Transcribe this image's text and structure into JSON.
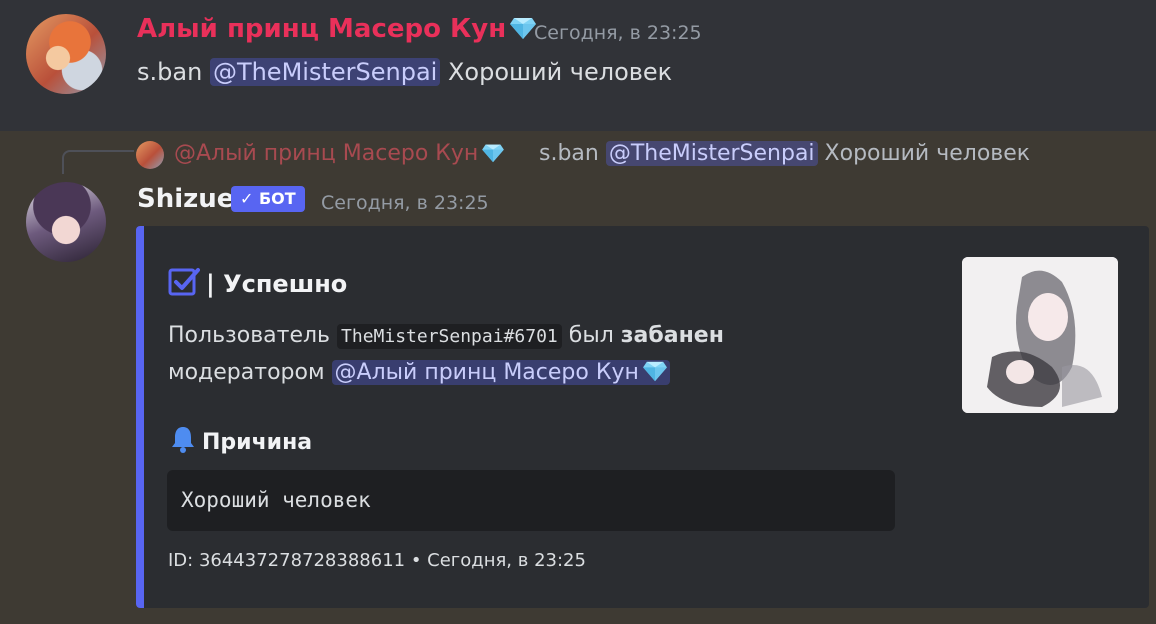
{
  "message1": {
    "author": "Алый принц Масеро Кун",
    "timestamp": "Сегодня, в 23:25",
    "command": "s.ban",
    "mention": "@TheMisterSenpai",
    "text": "Хороший человек"
  },
  "reply": {
    "author": "@Алый принц Масеро Кун",
    "command": "s.ban",
    "mention": "@TheMisterSenpai",
    "text": "Хороший человек"
  },
  "message2": {
    "author": "Shizue",
    "badge": "✓ БОТ",
    "timestamp": "Сегодня, в 23:25"
  },
  "embed": {
    "title": "| Успешно",
    "desc_prefix": "Пользователь",
    "user_tag": "TheMisterSenpai#6701",
    "desc_mid": "был",
    "desc_bold": "забанен",
    "desc_line2": "модератором",
    "moderator_mention": "@Алый принц Масеро Кун",
    "field_name": "Причина",
    "field_value": "Хороший человек",
    "footer": "ID: 364437278728388611 • Сегодня, в 23:25",
    "accent_color": "#5865f2"
  },
  "colors": {
    "author1": "#e9305a",
    "mention_bg": "#4a4f8f",
    "background": "#313338",
    "highlight_bg": "#3e3a33"
  }
}
